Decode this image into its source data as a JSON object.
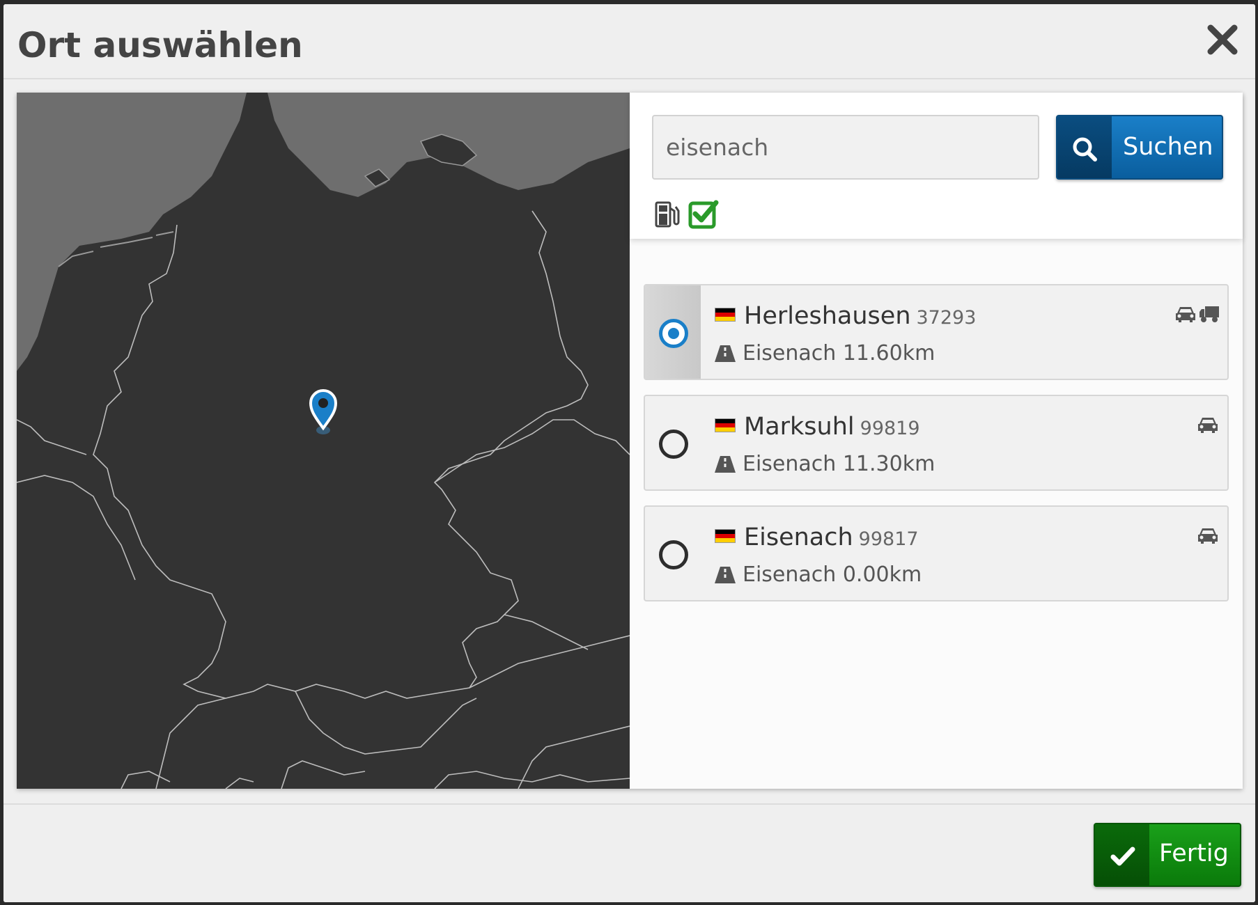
{
  "dialog": {
    "title": "Ort auswählen",
    "close_icon": "close-x-icon"
  },
  "search": {
    "value": "eisenach",
    "button_label": "Suchen",
    "button_icon": "search-icon",
    "filters": {
      "fuel_icon": "fuel-pump-icon",
      "fuel_checked": true
    }
  },
  "results": [
    {
      "name": "Herleshausen",
      "zip": "37293",
      "country_flag": "de-flag-icon",
      "distance_label": "Eisenach 11.60km",
      "vehicles": [
        "car-icon",
        "truck-icon"
      ],
      "selected": true
    },
    {
      "name": "Marksuhl",
      "zip": "99819",
      "country_flag": "de-flag-icon",
      "distance_label": "Eisenach 11.30km",
      "vehicles": [
        "car-icon"
      ],
      "selected": false
    },
    {
      "name": "Eisenach",
      "zip": "99817",
      "country_flag": "de-flag-icon",
      "distance_label": "Eisenach 0.00km",
      "vehicles": [
        "car-icon"
      ],
      "selected": false
    }
  ],
  "footer": {
    "done_label": "Fertig",
    "done_icon": "checkmark-icon"
  },
  "colors": {
    "primary_blue": "#1a7fc8",
    "success_green": "#1aa01a",
    "map_land": "#333333",
    "map_sea": "#6a6a6a",
    "flag_black": "#000000",
    "flag_red": "#dd0000",
    "flag_gold": "#ffce00"
  }
}
